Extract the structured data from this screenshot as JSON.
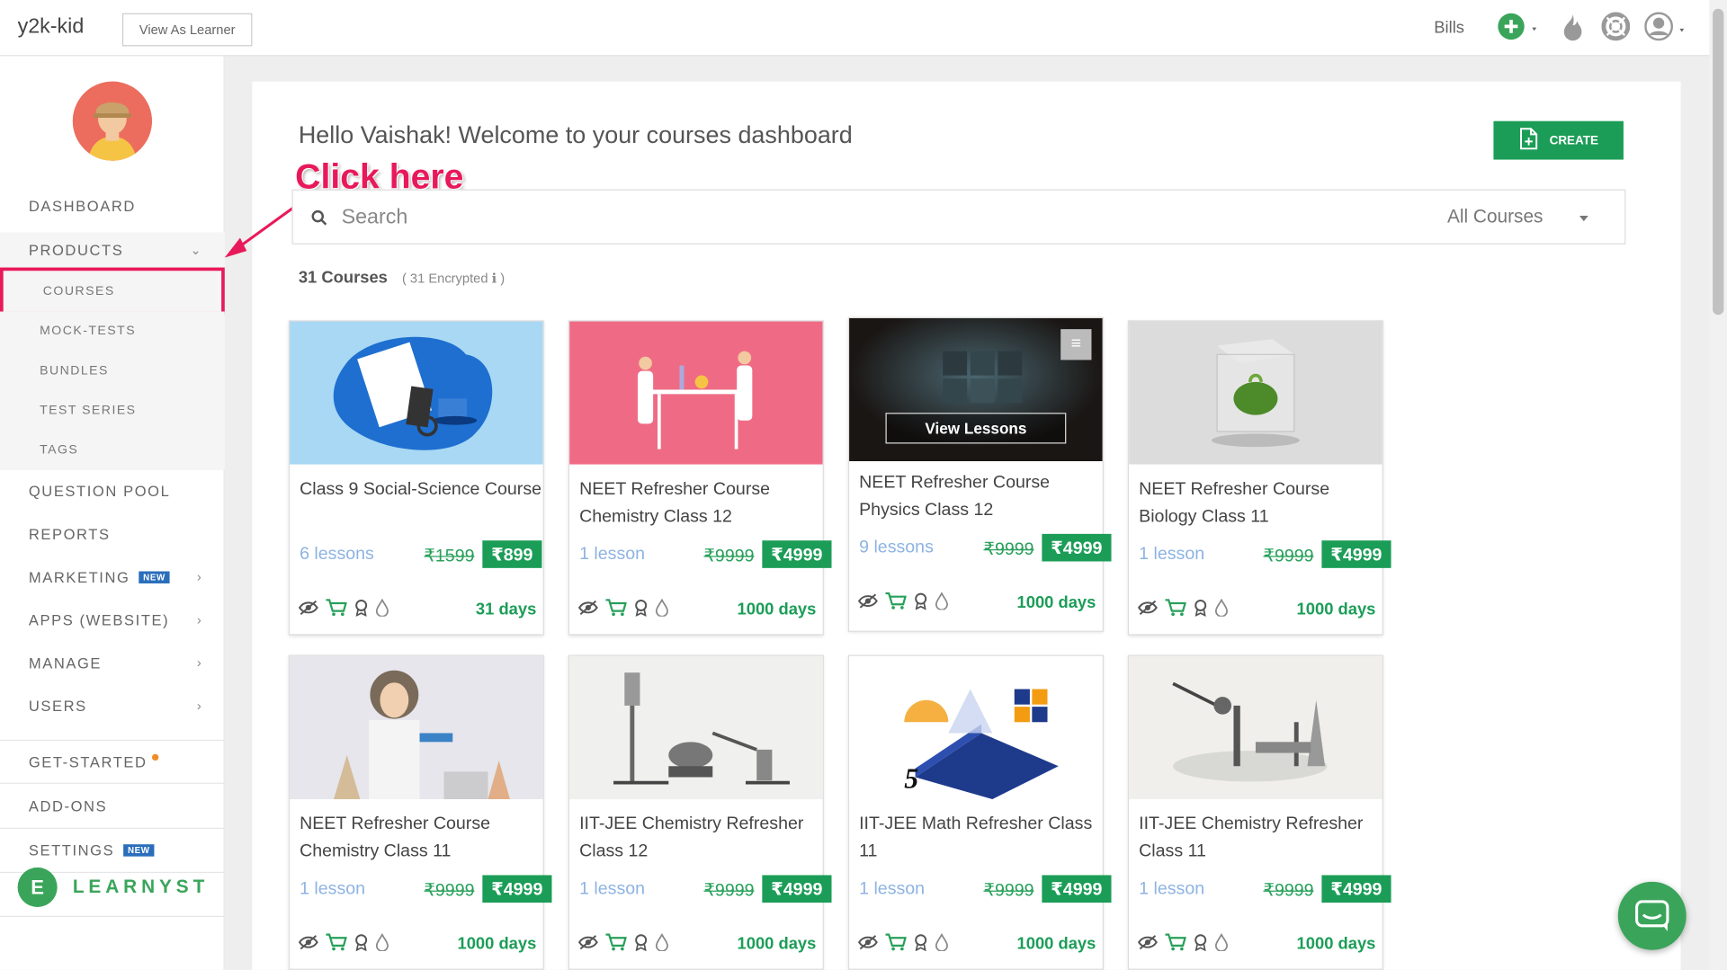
{
  "app": {
    "brand": "y2k-kid",
    "view_as_learner": "View As Learner",
    "bills": "Bills"
  },
  "sidebar": {
    "items": [
      {
        "label": "DASHBOARD"
      },
      {
        "label": "PRODUCTS"
      },
      {
        "label": "QUESTION POOL"
      },
      {
        "label": "REPORTS"
      },
      {
        "label": "MARKETING",
        "badge": "NEW"
      },
      {
        "label": "APPS (WEBSITE)"
      },
      {
        "label": "MANAGE"
      },
      {
        "label": "USERS"
      },
      {
        "label": "GET-STARTED"
      },
      {
        "label": "ADD-ONS"
      },
      {
        "label": "SETTINGS",
        "badge": "NEW"
      }
    ],
    "products_sub": [
      "COURSES",
      "MOCK-TESTS",
      "BUNDLES",
      "TEST SERIES",
      "TAGS"
    ],
    "footer_brand": "LEARNYST",
    "footer_logo_letter": "E"
  },
  "annotation": {
    "text": "Click here"
  },
  "main": {
    "welcome": "Hello Vaishak! Welcome to your courses dashboard",
    "create_label": "CREATE",
    "search_placeholder": "Search",
    "filter_value": "All Courses",
    "count": "31 Courses",
    "encrypted": "( 31 Encrypted ℹ )"
  },
  "courses": [
    {
      "title": "Class 9 Social-Science Course",
      "lessons": "6 lessons",
      "old_price": "₹1599",
      "price": "₹899",
      "days": "31 days"
    },
    {
      "title": "NEET Refresher Course Chemistry Class 12",
      "lessons": "1 lesson",
      "old_price": "₹9999",
      "price": "₹4999",
      "days": "1000 days"
    },
    {
      "title": "NEET Refresher Course Physics Class 12",
      "lessons": "9 lessons",
      "old_price": "₹9999",
      "price": "₹4999",
      "days": "1000 days",
      "overlay": "View Lessons"
    },
    {
      "title": "NEET Refresher Course Biology Class 11",
      "lessons": "1 lesson",
      "old_price": "₹9999",
      "price": "₹4999",
      "days": "1000 days"
    },
    {
      "title": "NEET Refresher Course Chemistry Class 11",
      "lessons": "1 lesson",
      "old_price": "₹9999",
      "price": "₹4999",
      "days": "1000 days"
    },
    {
      "title": "IIT-JEE Chemistry Refresher Class 12",
      "lessons": "1 lesson",
      "old_price": "₹9999",
      "price": "₹4999",
      "days": "1000 days"
    },
    {
      "title": "IIT-JEE Math Refresher Class 11",
      "lessons": "1 lesson",
      "old_price": "₹9999",
      "price": "₹4999",
      "days": "1000 days"
    },
    {
      "title": "IIT-JEE Chemistry Refresher Class 11",
      "lessons": "1 lesson",
      "old_price": "₹9999",
      "price": "₹4999",
      "days": "1000 days"
    }
  ],
  "colors": {
    "accent": "#1b9d57",
    "highlight": "#e8195a",
    "link": "#8db3e2"
  }
}
